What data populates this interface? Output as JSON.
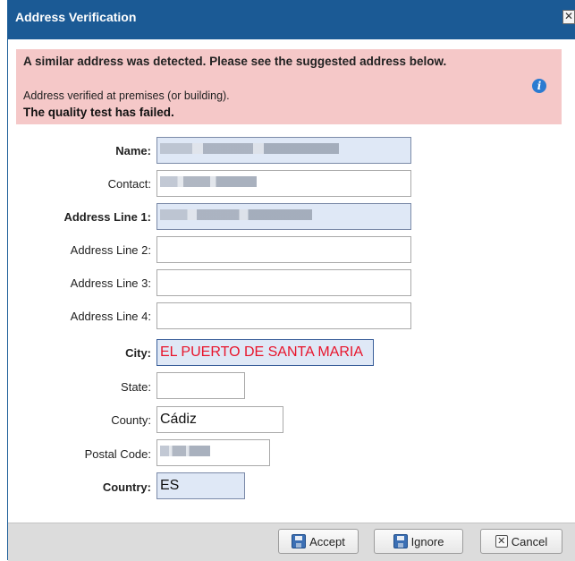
{
  "window": {
    "title": "Address Verification",
    "close_glyph": "✕"
  },
  "alert": {
    "heading": "A similar address was detected. Please see the suggested address below.",
    "detail": "Address verified at premises (or building).",
    "failed": "The quality test has failed.",
    "icon": "info-icon"
  },
  "form": {
    "name_label": "Name:",
    "contact_label": "Contact:",
    "address1_label": "Address Line 1:",
    "address2_label": "Address Line 2:",
    "address3_label": "Address Line 3:",
    "address4_label": "Address Line 4:",
    "city_label": "City:",
    "city_value": "EL PUERTO DE SANTA MARIA",
    "state_label": "State:",
    "county_label": "County:",
    "county_value": "Cádiz",
    "postal_label": "Postal Code:",
    "country_label": "Country:",
    "country_value": "ES"
  },
  "buttons": {
    "accept": "Accept",
    "ignore": "Ignore",
    "cancel": "Cancel",
    "cancel_glyph": "✕"
  },
  "colors": {
    "titlebar": "#1b5a95",
    "alert_bg": "#f5c8c8",
    "required_field_bg": "#dfe8f6",
    "error_text": "#e8142b"
  }
}
